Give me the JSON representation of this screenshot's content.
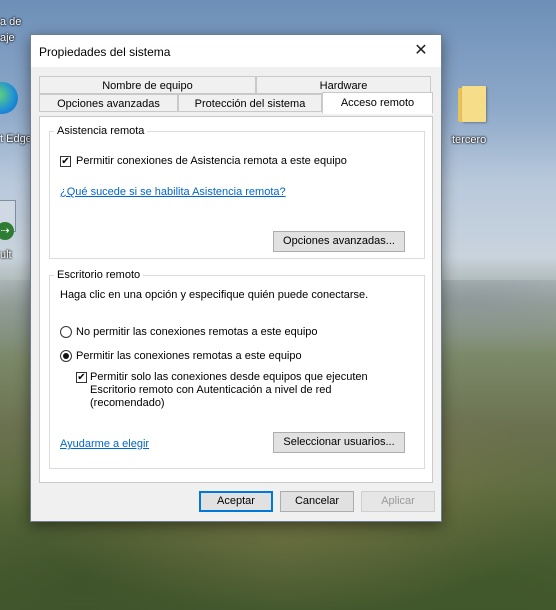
{
  "desktop": {
    "left_icons": [
      {
        "label": "a de"
      },
      {
        "label": "aje"
      },
      {
        "label": "t Edge"
      },
      {
        "label": "ult"
      }
    ],
    "folder_label": "tercero"
  },
  "dialog": {
    "title": "Propiedades del sistema",
    "close_glyph": "✕",
    "tabs_row1": [
      "Nombre de equipo",
      "Hardware"
    ],
    "tabs_row2": [
      "Opciones avanzadas",
      "Protección del sistema",
      "Acceso remoto"
    ],
    "active_tab": "Acceso remoto",
    "remote_assistance": {
      "group_label": "Asistencia remota",
      "allow_checkbox": {
        "label": "Permitir conexiones de Asistencia remota a este equipo",
        "checked": true
      },
      "help_link": "¿Qué sucede si se habilita Asistencia remota?",
      "advanced_button": "Opciones avanzadas..."
    },
    "remote_desktop": {
      "group_label": "Escritorio remoto",
      "instruction": "Haga clic en una opción y especifique quién puede conectarse.",
      "option_deny": {
        "label": "No permitir las conexiones remotas a este equipo",
        "selected": false
      },
      "option_allow": {
        "label": "Permitir las conexiones remotas a este equipo",
        "selected": true
      },
      "nla_checkbox": {
        "line1": "Permitir solo las conexiones desde equipos que ejecuten",
        "line2": "Escritorio remoto con Autenticación a nivel de red",
        "line3": "(recomendado)",
        "checked": true
      },
      "help_link": "Ayudarme a elegir",
      "select_users_button": "Seleccionar usuarios..."
    },
    "buttons": {
      "ok": "Aceptar",
      "cancel": "Cancelar",
      "apply": "Aplicar"
    }
  }
}
